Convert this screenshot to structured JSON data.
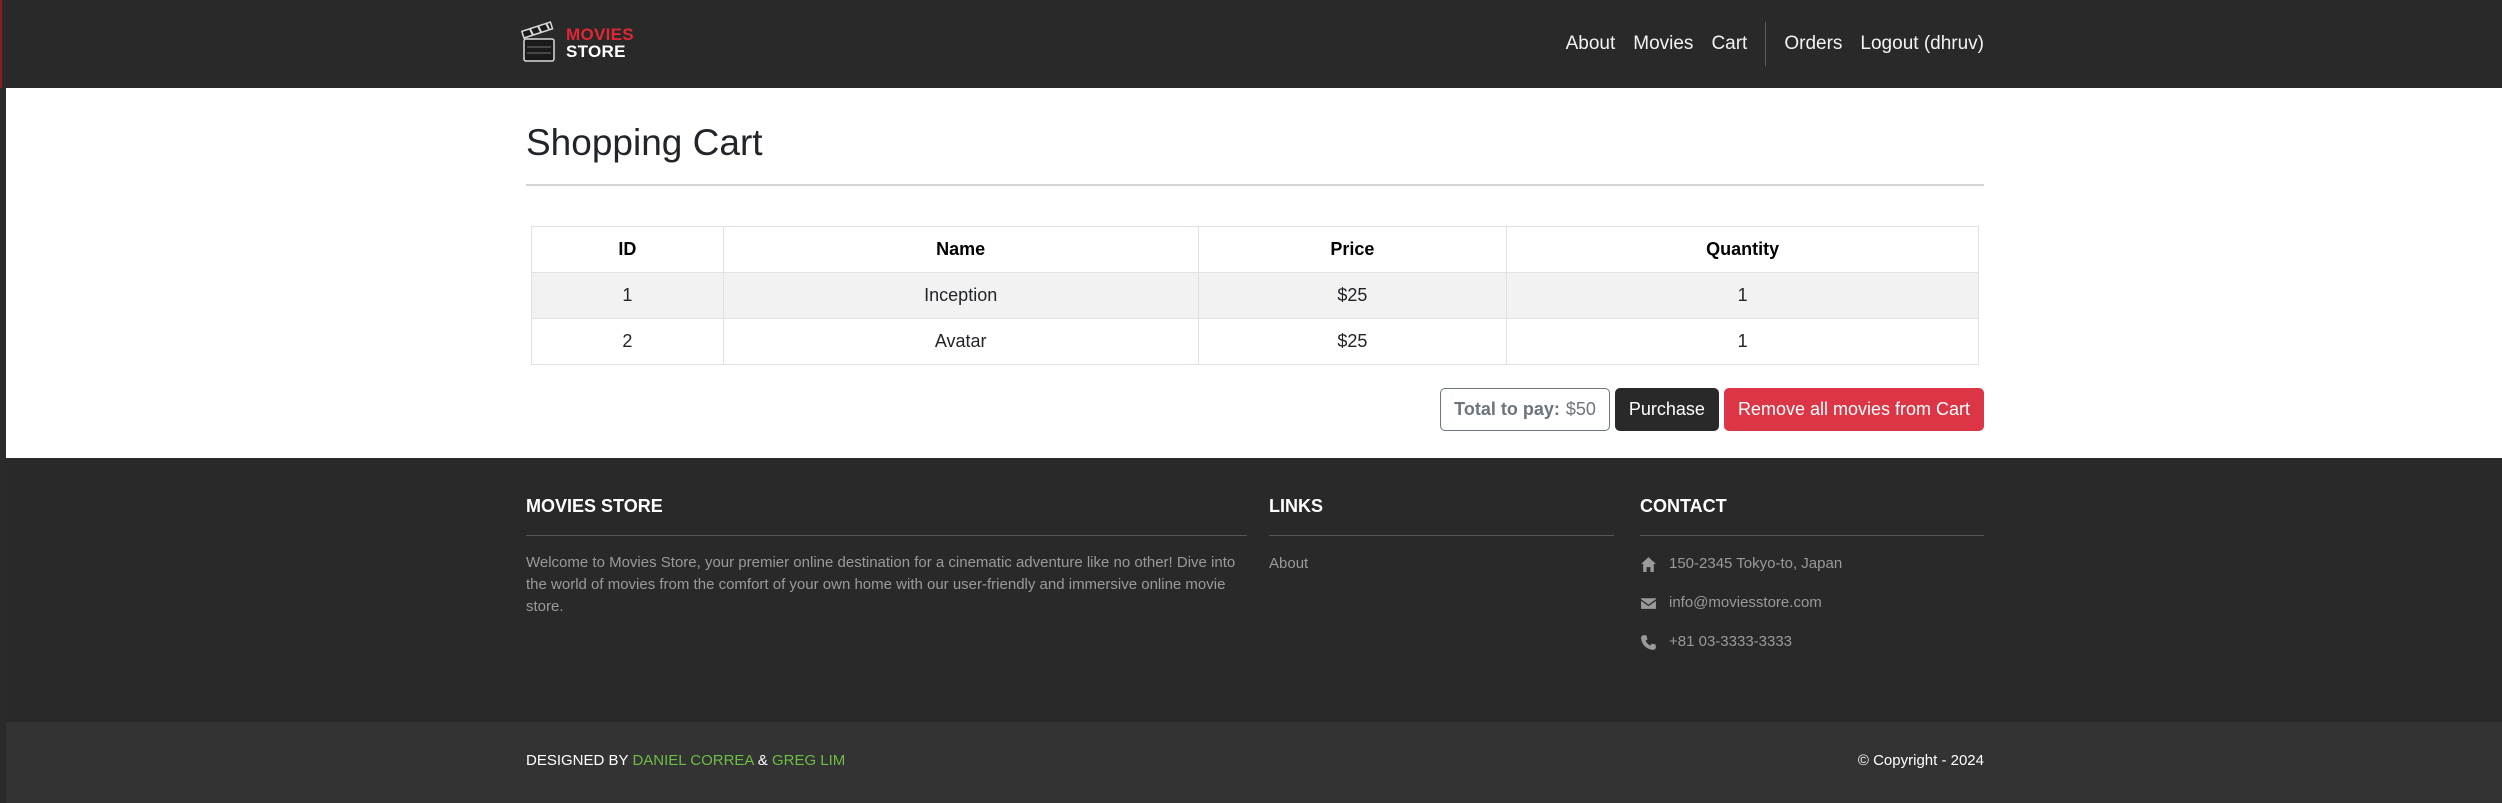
{
  "brand": {
    "line1": "MOVIES",
    "line2": "STORE"
  },
  "nav": {
    "about": "About",
    "movies": "Movies",
    "cart": "Cart",
    "orders": "Orders",
    "logout": "Logout (dhruv)"
  },
  "page": {
    "title": "Shopping Cart"
  },
  "table": {
    "headers": [
      "ID",
      "Name",
      "Price",
      "Quantity"
    ],
    "rows": [
      [
        "1",
        "Inception",
        "$25",
        "1"
      ],
      [
        "2",
        "Avatar",
        "$25",
        "1"
      ]
    ]
  },
  "actions": {
    "total_label": "Total to pay:",
    "total_value": "$50",
    "purchase": "Purchase",
    "remove_all": "Remove all movies from Cart"
  },
  "footer": {
    "store_heading": "MOVIES STORE",
    "store_text": "Welcome to Movies Store, your premier online destination for a cinematic adventure like no other! Dive into the world of movies from the comfort of your own home with our user-friendly and immersive online movie store.",
    "links_heading": "LINKS",
    "links": [
      "About"
    ],
    "contact_heading": "CONTACT",
    "address": "150-2345 Tokyo-to, Japan",
    "email": "info@moviesstore.com",
    "phone": "+81 03-3333-3333",
    "icons": [
      "home-icon",
      "envelope-icon",
      "phone-icon"
    ]
  },
  "bottom": {
    "designed_by": "DESIGNED BY",
    "author1": "DANIEL CORREA",
    "amp": "&",
    "author2": "GREG LIM",
    "copyright": "© Copyright - 2024"
  },
  "colors": {
    "navbar": "#292929",
    "brand_red": "#e02733",
    "danger": "#dc3545",
    "accent_green": "#6cbe45"
  }
}
